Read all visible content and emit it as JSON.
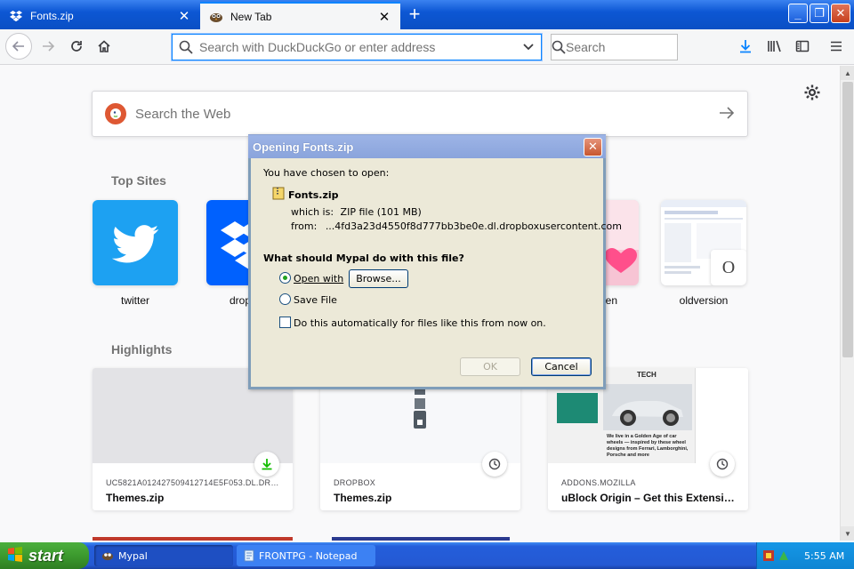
{
  "tabs": [
    {
      "label": "Fonts.zip",
      "icon": "dropbox-icon",
      "active": false
    },
    {
      "label": "New Tab",
      "icon": "mypal-icon",
      "active": true
    }
  ],
  "navbar": {
    "url_placeholder": "Search with DuckDuckGo or enter address",
    "search_placeholder": "Search"
  },
  "newtab": {
    "web_search_placeholder": "Search the Web",
    "top_sites_heading": "Top Sites",
    "highlights_heading": "Highlights",
    "top_sites": [
      {
        "label": "twitter",
        "icon": "twitter-icon",
        "color": "#1da1f2"
      },
      {
        "label": "drop",
        "icon": "dropbox-icon",
        "color": "#0061fe"
      },
      {
        "label": "en",
        "icon": "heart-icon",
        "color": "#f7c4d4"
      },
      {
        "label": "oldversion",
        "icon": "oldversion-icon",
        "color": "#ffffff",
        "letter": "O"
      }
    ],
    "highlights": [
      {
        "source": "UC5821A012427509412714E5F053.DL.DRO...",
        "title": "Themes.zip",
        "badge": "download-icon"
      },
      {
        "source": "DROPBOX",
        "title": "Themes.zip",
        "badge": "clock-icon"
      },
      {
        "source": "ADDONS.MOZILLA",
        "title": "uBlock Origin – Get this Extensio...",
        "badge": "clock-icon",
        "preview_heading": "TECH",
        "preview_caption": "We live in a Golden Age of car wheels — inspired by these wheel designs from Ferrari, Lamborghini, Porsche and more"
      }
    ]
  },
  "dialog": {
    "title": "Opening Fonts.zip",
    "intro": "You have chosen to open:",
    "filename": "Fonts.zip",
    "which_is_label": "which is:",
    "which_is_value": "ZIP file (101 MB)",
    "from_label": "from:",
    "from_value": "...4fd3a23d4550f8d777bb3be0e.dl.dropboxusercontent.com",
    "question": "What should Mypal do with this file?",
    "open_with_label": "Open with",
    "browse_label": "Browse...",
    "save_file_label": "Save File",
    "auto_label": "Do this automatically for files like this from now on.",
    "ok_label": "OK",
    "cancel_label": "Cancel",
    "selected_option": "Open with",
    "auto_checked": false
  },
  "taskbar": {
    "start_label": "start",
    "tasks": [
      {
        "label": "Mypal",
        "active": true
      },
      {
        "label": "FRONTPG - Notepad",
        "active": false
      }
    ],
    "clock": "5:55 AM"
  }
}
